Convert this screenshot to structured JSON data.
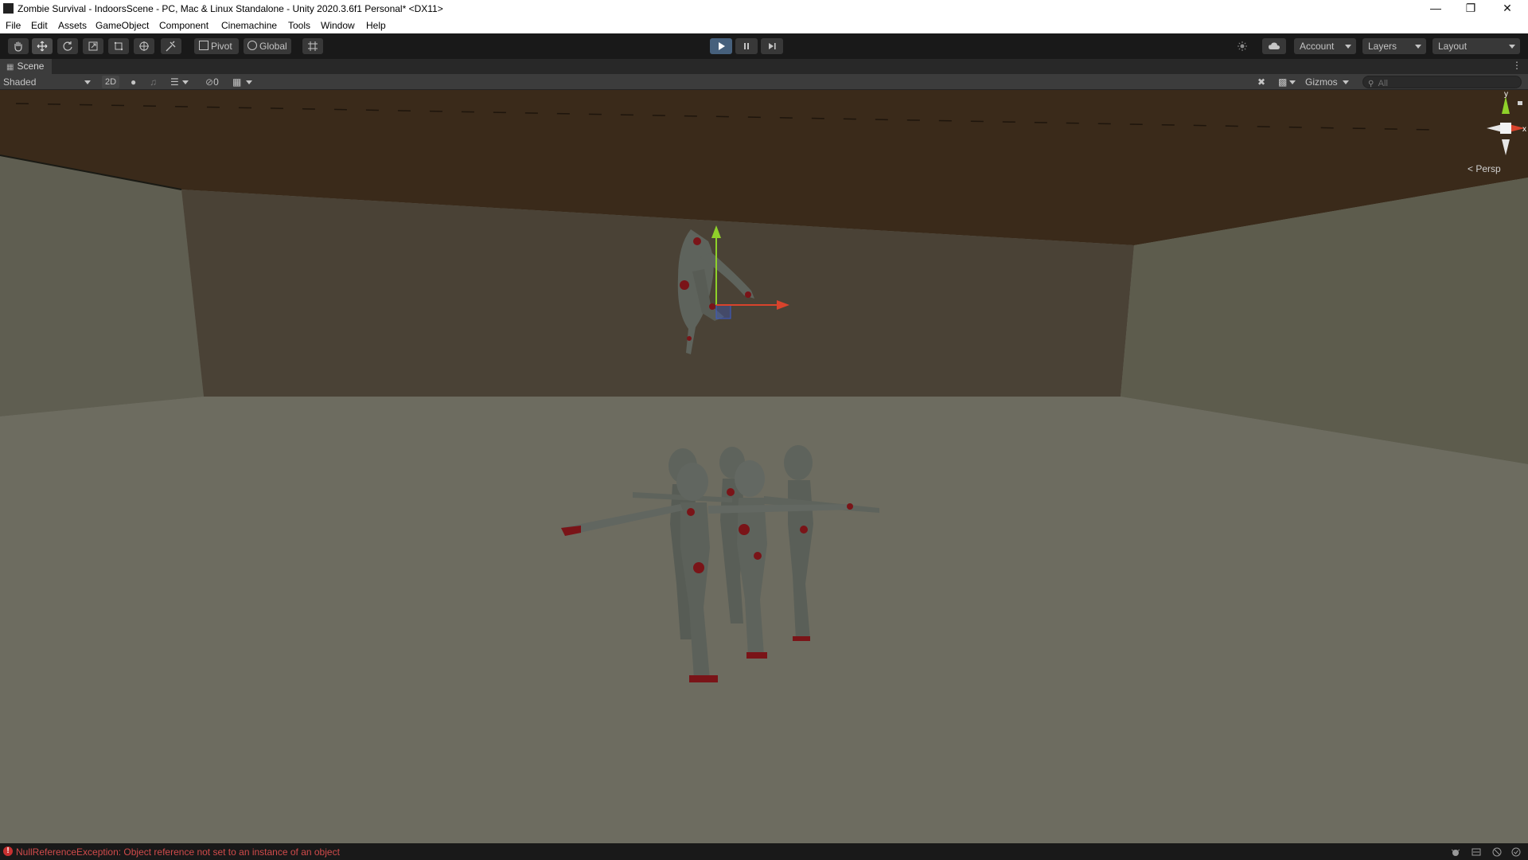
{
  "window": {
    "title": "Zombie Survival - IndoorsScene - PC, Mac & Linux Standalone - Unity 2020.3.6f1 Personal* <DX11>",
    "controls": [
      "minimize",
      "restore",
      "close"
    ]
  },
  "menu": [
    "File",
    "Edit",
    "Assets",
    "GameObject",
    "Component",
    "Cinemachine",
    "Tools",
    "Window",
    "Help"
  ],
  "toolbar": {
    "tools": [
      "hand-tool",
      "move-tool",
      "rotate-tool",
      "scale-tool",
      "rect-tool",
      "transform-tool",
      "custom-tool"
    ],
    "active_tool": "move-tool",
    "pivot_label": "Pivot",
    "global_label": "Global",
    "play_state": "playing",
    "account_label": "Account",
    "layers_label": "Layers",
    "layout_label": "Layout"
  },
  "scene_tab": {
    "label": "Scene"
  },
  "scene_toolbar": {
    "draw_mode": "Shaded",
    "mode_2d": "2D",
    "hidden_count": "0",
    "gizmos_label": "Gizmos",
    "search_placeholder": "All"
  },
  "viewport": {
    "projection_label": "< Persp",
    "axis_y": "y",
    "axis_x": "x",
    "colors": {
      "ceiling": "#3a2a1a",
      "back_wall": "#4a4236",
      "left_wall": "#5f5e51",
      "right_wall": "#5d5c4d",
      "floor": "#6d6c60",
      "zombie_skin": "#5e635c",
      "zombie_blood": "#7a1418",
      "axis_x": "#d8432c",
      "axis_y": "#8fd12a",
      "axis_z": "#3a59c8"
    }
  },
  "status": {
    "message": "NullReferenceException: Object reference not set to an instance of an object",
    "level": "error"
  }
}
